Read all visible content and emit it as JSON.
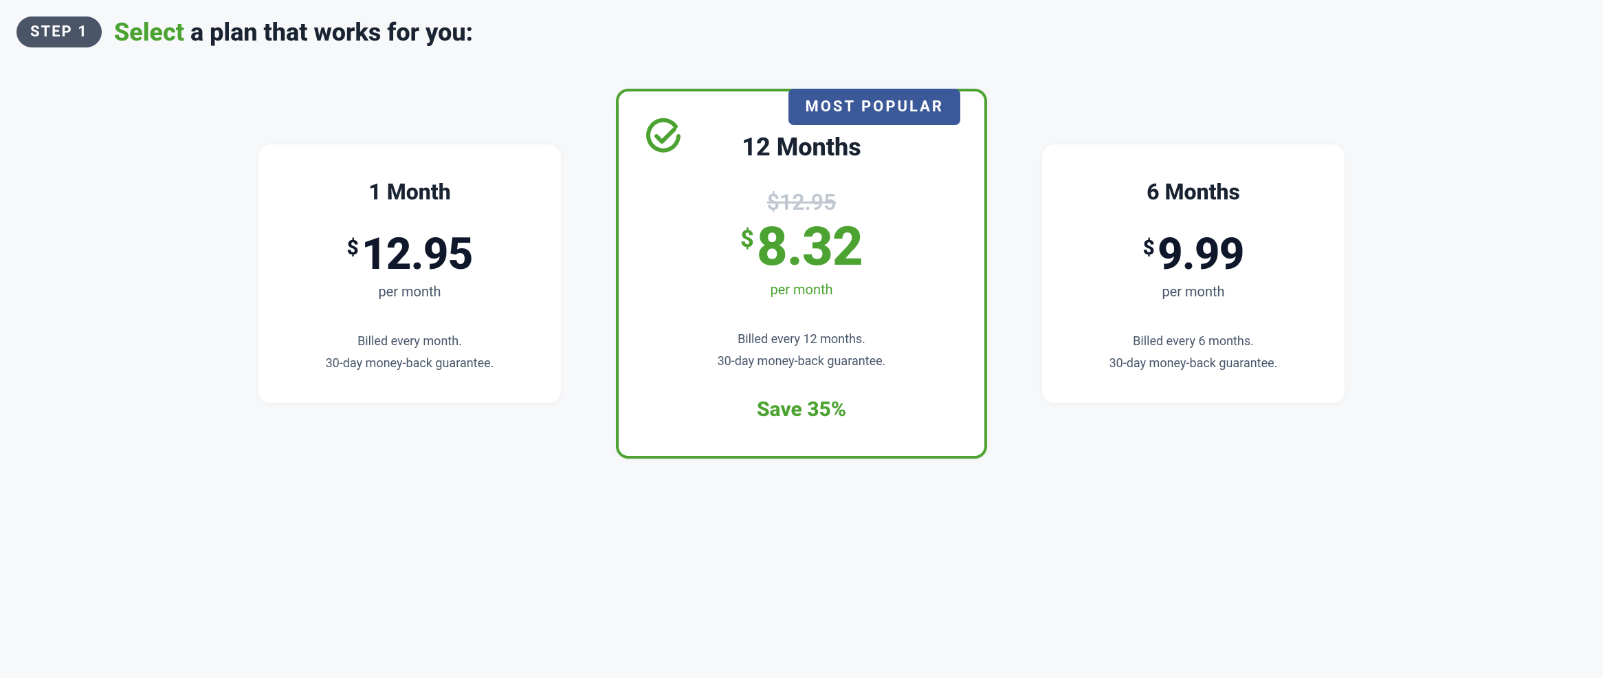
{
  "header": {
    "step_label": "STEP 1",
    "title_highlight": "Select",
    "title_rest": " a plan that works for you:"
  },
  "plans": [
    {
      "title": "1 Month",
      "currency": "$",
      "price": "12.95",
      "per_month": "per month",
      "billing_line1": "Billed every month.",
      "billing_line2": "30-day money-back guarantee."
    },
    {
      "title": "12 Months",
      "popular_label": "MOST POPULAR",
      "strikethrough": "$12.95",
      "currency": "$",
      "price": "8.32",
      "per_month": "per month",
      "billing_line1": "Billed every 12 months.",
      "billing_line2": "30-day money-back guarantee.",
      "save_label": "Save 35%"
    },
    {
      "title": "6 Months",
      "currency": "$",
      "price": "9.99",
      "per_month": "per month",
      "billing_line1": "Billed every 6 months.",
      "billing_line2": "30-day money-back guarantee."
    }
  ]
}
